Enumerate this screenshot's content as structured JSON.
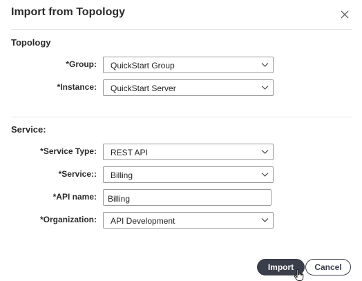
{
  "dialog": {
    "title": "Import from Topology",
    "close_icon": "close-icon"
  },
  "topology": {
    "heading": "Topology",
    "group": {
      "label": "*Group:",
      "value": "QuickStart Group"
    },
    "instance": {
      "label": "*Instance:",
      "value": "QuickStart Server"
    }
  },
  "service": {
    "heading": "Service:",
    "service_type": {
      "label": "*Service Type:",
      "value": "REST API"
    },
    "service": {
      "label": "*Service::",
      "value": "Billing"
    },
    "api_name": {
      "label": "*API name:",
      "value": "Billing"
    },
    "organization": {
      "label": "*Organization:",
      "value": "API Development"
    }
  },
  "footer": {
    "import_label": "Import",
    "cancel_label": "Cancel"
  },
  "colors": {
    "primary_button": "#3a3d4a",
    "divider": "#e2e2e2",
    "field_border": "#9a9a9a"
  }
}
